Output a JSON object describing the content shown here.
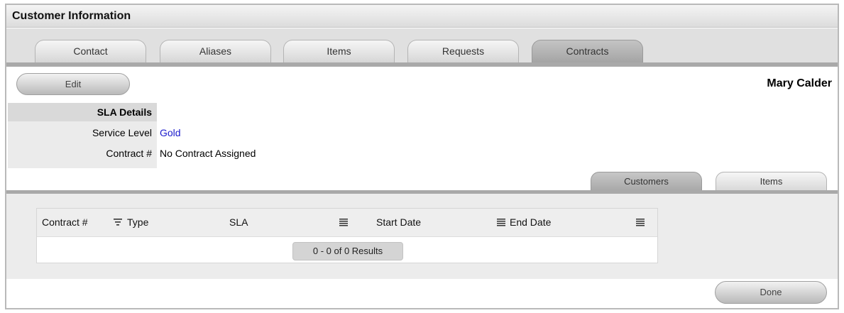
{
  "window": {
    "title": "Customer Information"
  },
  "tabs": [
    {
      "label": "Contact"
    },
    {
      "label": "Aliases"
    },
    {
      "label": "Items"
    },
    {
      "label": "Requests"
    },
    {
      "label": "Contracts",
      "active": true
    }
  ],
  "toolbar": {
    "edit_label": "Edit",
    "done_label": "Done"
  },
  "customer": {
    "name": "Mary Calder"
  },
  "sla": {
    "heading": "SLA Details",
    "service_level_label": "Service Level",
    "service_level_value": "Gold",
    "contract_label": "Contract #",
    "contract_value": "No Contract Assigned"
  },
  "subtabs": [
    {
      "label": "Customers",
      "active": true
    },
    {
      "label": "Items"
    }
  ],
  "contracts_table": {
    "columns": [
      "Contract #",
      "Type",
      "SLA",
      "Start Date",
      "End Date"
    ],
    "rows": [],
    "results_text": "0 - 0 of 0 Results"
  },
  "colors": {
    "link": "#1a1acc",
    "active_tab": "#a3a3a3",
    "panel_bg": "#ececec"
  },
  "icons": {
    "sort_filter": "filter-lines-icon",
    "column_menu": "column-menu-icon"
  }
}
